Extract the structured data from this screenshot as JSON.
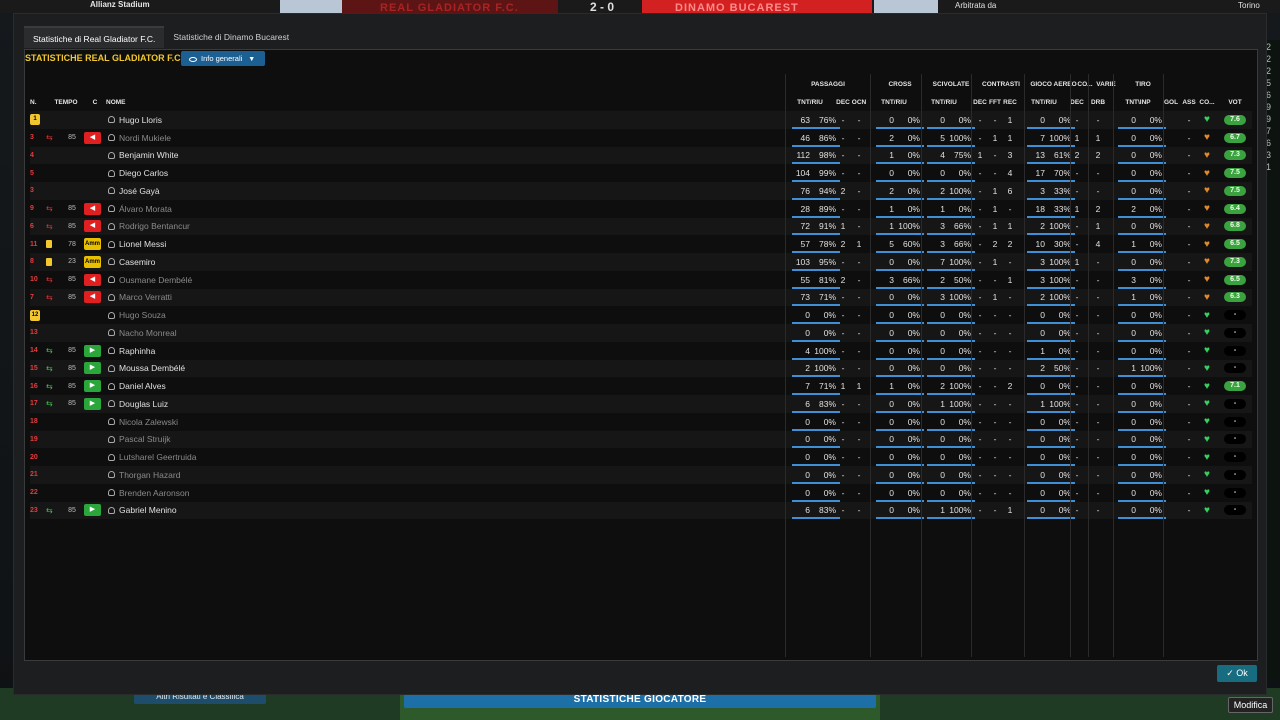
{
  "topbar": {
    "stadium": "Allianz Stadium",
    "referee_label": "Arbitrata da",
    "city": "Torino",
    "home_team_banner": "REAL GLADIATOR F.C.",
    "away_team_banner": "DINAMO BUCAREST",
    "score": "2 - 0"
  },
  "dialog": {
    "tabs": [
      "Statistiche di Real Gladiator F.C.",
      "Statistiche di Dinamo Bucarest"
    ],
    "panel_title": "STATISTICHE REAL GLADIATOR F.C.",
    "view_button": "Info generali",
    "group_headers": {
      "passaggi": "PASSAGGI",
      "cross": "CROSS",
      "scivolate": "SCIVOLATE",
      "contrasti": "CONTRASTI",
      "gioco_aereo": "GIOCO AEREO",
      "co": "CO...",
      "varie": "VARIE",
      "tiro": "TIRO"
    },
    "col_headers": {
      "n": "N.",
      "tempo": "TEMPO",
      "c": "C",
      "nome": "NOME",
      "tnt_riu": "TNT/RIU",
      "dec": "DEC",
      "ocn": "OCN",
      "fft": "FFT",
      "rec": "REC",
      "drb": "DRB",
      "tnt_inp": "TNT\\INP",
      "gol": "GOL",
      "ass": "ASS",
      "co": "CO...",
      "vot": "VOT"
    },
    "rows": [
      {
        "n": "1",
        "shirt": true,
        "dim": false,
        "tempo": "",
        "event": "",
        "cbox": "",
        "name": "Hugo Lloris",
        "pa": "63",
        "pp": "76%",
        "dec": "-",
        "ocn": "-",
        "cra": "0",
        "crp": "0%",
        "sca": "0",
        "scp": "0%",
        "cd": "-",
        "cf": "-",
        "cr": "1",
        "gaa": "0",
        "gap": "0%",
        "co": "-",
        "dr": "-",
        "ta": "0",
        "tp": "0%",
        "gol": "",
        "ass": "-",
        "heart": "#36d160",
        "vot": "7.6",
        "vg": true
      },
      {
        "n": "3",
        "shirt": false,
        "dim": true,
        "tempo": "85",
        "event": "out",
        "cbox": "red",
        "name": "Nordi Mukiele",
        "pa": "46",
        "pp": "86%",
        "dec": "-",
        "ocn": "-",
        "cra": "2",
        "crp": "0%",
        "sca": "5",
        "scp": "100%",
        "cd": "-",
        "cf": "1",
        "cr": "1",
        "gaa": "7",
        "gap": "100%",
        "co": "1",
        "dr": "1",
        "ta": "0",
        "tp": "0%",
        "gol": "",
        "ass": "-",
        "heart": "#e08a2c",
        "vot": "6.7",
        "vg": true
      },
      {
        "n": "4",
        "shirt": false,
        "dim": false,
        "tempo": "",
        "event": "",
        "cbox": "",
        "name": "Benjamin White",
        "pa": "112",
        "pp": "98%",
        "dec": "-",
        "ocn": "-",
        "cra": "1",
        "crp": "0%",
        "sca": "4",
        "scp": "75%",
        "cd": "1",
        "cf": "-",
        "cr": "3",
        "gaa": "13",
        "gap": "61%",
        "co": "2",
        "dr": "2",
        "ta": "0",
        "tp": "0%",
        "gol": "",
        "ass": "-",
        "heart": "#e08a2c",
        "vot": "7.3",
        "vg": true
      },
      {
        "n": "5",
        "shirt": false,
        "dim": false,
        "tempo": "",
        "event": "",
        "cbox": "",
        "name": "Diego Carlos",
        "pa": "104",
        "pp": "99%",
        "dec": "-",
        "ocn": "-",
        "cra": "0",
        "crp": "0%",
        "sca": "0",
        "scp": "0%",
        "cd": "-",
        "cf": "-",
        "cr": "4",
        "gaa": "17",
        "gap": "70%",
        "co": "-",
        "dr": "-",
        "ta": "0",
        "tp": "0%",
        "gol": "",
        "ass": "-",
        "heart": "#e08a2c",
        "vot": "7.5",
        "vg": true
      },
      {
        "n": "3",
        "shirt": false,
        "dim": false,
        "tempo": "",
        "event": "",
        "cbox": "",
        "name": "José Gayà",
        "pa": "76",
        "pp": "94%",
        "dec": "2",
        "ocn": "-",
        "cra": "2",
        "crp": "0%",
        "sca": "2",
        "scp": "100%",
        "cd": "-",
        "cf": "1",
        "cr": "6",
        "gaa": "3",
        "gap": "33%",
        "co": "-",
        "dr": "-",
        "ta": "0",
        "tp": "0%",
        "gol": "",
        "ass": "-",
        "heart": "#e08a2c",
        "vot": "7.5",
        "vg": true
      },
      {
        "n": "9",
        "shirt": false,
        "dim": true,
        "tempo": "85",
        "event": "out",
        "cbox": "red",
        "name": "Álvaro Morata",
        "pa": "28",
        "pp": "89%",
        "dec": "-",
        "ocn": "-",
        "cra": "1",
        "crp": "0%",
        "sca": "1",
        "scp": "0%",
        "cd": "-",
        "cf": "1",
        "cr": "-",
        "gaa": "18",
        "gap": "33%",
        "co": "1",
        "dr": "2",
        "ta": "2",
        "tp": "0%",
        "gol": "",
        "ass": "-",
        "heart": "#e08a2c",
        "vot": "6.4",
        "vg": true
      },
      {
        "n": "6",
        "shirt": false,
        "dim": true,
        "tempo": "85",
        "event": "out",
        "cbox": "red",
        "name": "Rodrigo Bentancur",
        "pa": "72",
        "pp": "91%",
        "dec": "1",
        "ocn": "-",
        "cra": "1",
        "crp": "100%",
        "sca": "3",
        "scp": "66%",
        "cd": "-",
        "cf": "1",
        "cr": "1",
        "gaa": "2",
        "gap": "100%",
        "co": "-",
        "dr": "1",
        "ta": "0",
        "tp": "0%",
        "gol": "",
        "ass": "-",
        "heart": "#e08a2c",
        "vot": "6.8",
        "vg": true
      },
      {
        "n": "11",
        "shirt": false,
        "dim": false,
        "tempo": "78",
        "event": "yellow",
        "cbox": "amm",
        "name": "Lionel Messi",
        "pa": "57",
        "pp": "78%",
        "dec": "2",
        "ocn": "1",
        "cra": "5",
        "crp": "60%",
        "sca": "3",
        "scp": "66%",
        "cd": "-",
        "cf": "2",
        "cr": "2",
        "gaa": "10",
        "gap": "30%",
        "co": "-",
        "dr": "4",
        "ta": "1",
        "tp": "0%",
        "gol": "",
        "ass": "-",
        "heart": "#e08a2c",
        "vot": "6.5",
        "vg": true
      },
      {
        "n": "8",
        "shirt": false,
        "dim": false,
        "tempo": "23",
        "event": "yellow",
        "cbox": "amm",
        "name": "Casemiro",
        "pa": "103",
        "pp": "95%",
        "dec": "-",
        "ocn": "-",
        "cra": "0",
        "crp": "0%",
        "sca": "7",
        "scp": "100%",
        "cd": "-",
        "cf": "1",
        "cr": "-",
        "gaa": "3",
        "gap": "100%",
        "co": "1",
        "dr": "-",
        "ta": "0",
        "tp": "0%",
        "gol": "",
        "ass": "-",
        "heart": "#e08a2c",
        "vot": "7.3",
        "vg": true
      },
      {
        "n": "10",
        "shirt": false,
        "dim": true,
        "tempo": "85",
        "event": "out",
        "cbox": "red",
        "name": "Ousmane Dembélé",
        "pa": "55",
        "pp": "81%",
        "dec": "2",
        "ocn": "-",
        "cra": "3",
        "crp": "66%",
        "sca": "2",
        "scp": "50%",
        "cd": "-",
        "cf": "-",
        "cr": "1",
        "gaa": "3",
        "gap": "100%",
        "co": "-",
        "dr": "-",
        "ta": "3",
        "tp": "0%",
        "gol": "",
        "ass": "-",
        "heart": "#e08a2c",
        "vot": "6.5",
        "vg": true
      },
      {
        "n": "7",
        "shirt": false,
        "dim": true,
        "tempo": "85",
        "event": "out",
        "cbox": "red",
        "name": "Marco Verratti",
        "pa": "73",
        "pp": "71%",
        "dec": "-",
        "ocn": "-",
        "cra": "0",
        "crp": "0%",
        "sca": "3",
        "scp": "100%",
        "cd": "-",
        "cf": "1",
        "cr": "-",
        "gaa": "2",
        "gap": "100%",
        "co": "-",
        "dr": "-",
        "ta": "1",
        "tp": "0%",
        "gol": "",
        "ass": "-",
        "heart": "#e08a2c",
        "vot": "6.3",
        "vg": true
      },
      {
        "n": "12",
        "shirt": true,
        "dim": true,
        "tempo": "",
        "event": "",
        "cbox": "",
        "name": "Hugo Souza",
        "pa": "0",
        "pp": "0%",
        "dec": "-",
        "ocn": "-",
        "cra": "0",
        "crp": "0%",
        "sca": "0",
        "scp": "0%",
        "cd": "-",
        "cf": "-",
        "cr": "-",
        "gaa": "0",
        "gap": "0%",
        "co": "-",
        "dr": "-",
        "ta": "0",
        "tp": "0%",
        "gol": "",
        "ass": "-",
        "heart": "#36d160",
        "vot": "-",
        "vg": false
      },
      {
        "n": "13",
        "shirt": false,
        "dim": true,
        "tempo": "",
        "event": "",
        "cbox": "",
        "name": "Nacho Monreal",
        "pa": "0",
        "pp": "0%",
        "dec": "-",
        "ocn": "-",
        "cra": "0",
        "crp": "0%",
        "sca": "0",
        "scp": "0%",
        "cd": "-",
        "cf": "-",
        "cr": "-",
        "gaa": "0",
        "gap": "0%",
        "co": "-",
        "dr": "-",
        "ta": "0",
        "tp": "0%",
        "gol": "",
        "ass": "-",
        "heart": "#36d160",
        "vot": "-",
        "vg": false
      },
      {
        "n": "14",
        "shirt": false,
        "dim": false,
        "tempo": "85",
        "event": "in",
        "cbox": "green",
        "name": "Raphinha",
        "pa": "4",
        "pp": "100%",
        "dec": "-",
        "ocn": "-",
        "cra": "0",
        "crp": "0%",
        "sca": "0",
        "scp": "0%",
        "cd": "-",
        "cf": "-",
        "cr": "-",
        "gaa": "1",
        "gap": "0%",
        "co": "-",
        "dr": "-",
        "ta": "0",
        "tp": "0%",
        "gol": "",
        "ass": "-",
        "heart": "#36d160",
        "vot": "-",
        "vg": false
      },
      {
        "n": "15",
        "shirt": false,
        "dim": false,
        "tempo": "85",
        "event": "in",
        "cbox": "green",
        "name": "Moussa Dembélé",
        "pa": "2",
        "pp": "100%",
        "dec": "-",
        "ocn": "-",
        "cra": "0",
        "crp": "0%",
        "sca": "0",
        "scp": "0%",
        "cd": "-",
        "cf": "-",
        "cr": "-",
        "gaa": "2",
        "gap": "50%",
        "co": "-",
        "dr": "-",
        "ta": "1",
        "tp": "100%",
        "gol": "",
        "ass": "-",
        "heart": "#36d160",
        "vot": "-",
        "vg": false
      },
      {
        "n": "16",
        "shirt": false,
        "dim": false,
        "tempo": "85",
        "event": "in",
        "cbox": "green",
        "name": "Daniel Alves",
        "pa": "7",
        "pp": "71%",
        "dec": "1",
        "ocn": "1",
        "cra": "1",
        "crp": "0%",
        "sca": "2",
        "scp": "100%",
        "cd": "-",
        "cf": "-",
        "cr": "2",
        "gaa": "0",
        "gap": "0%",
        "co": "-",
        "dr": "-",
        "ta": "0",
        "tp": "0%",
        "gol": "",
        "ass": "-",
        "heart": "#36d160",
        "vot": "7.1",
        "vg": true
      },
      {
        "n": "17",
        "shirt": false,
        "dim": false,
        "tempo": "85",
        "event": "in",
        "cbox": "green",
        "name": "Douglas Luiz",
        "pa": "6",
        "pp": "83%",
        "dec": "-",
        "ocn": "-",
        "cra": "0",
        "crp": "0%",
        "sca": "1",
        "scp": "100%",
        "cd": "-",
        "cf": "-",
        "cr": "-",
        "gaa": "1",
        "gap": "100%",
        "co": "-",
        "dr": "-",
        "ta": "0",
        "tp": "0%",
        "gol": "",
        "ass": "-",
        "heart": "#36d160",
        "vot": "-",
        "vg": false
      },
      {
        "n": "18",
        "shirt": false,
        "dim": true,
        "tempo": "",
        "event": "",
        "cbox": "",
        "name": "Nicola Zalewski",
        "pa": "0",
        "pp": "0%",
        "dec": "-",
        "ocn": "-",
        "cra": "0",
        "crp": "0%",
        "sca": "0",
        "scp": "0%",
        "cd": "-",
        "cf": "-",
        "cr": "-",
        "gaa": "0",
        "gap": "0%",
        "co": "-",
        "dr": "-",
        "ta": "0",
        "tp": "0%",
        "gol": "",
        "ass": "-",
        "heart": "#36d160",
        "vot": "-",
        "vg": false
      },
      {
        "n": "19",
        "shirt": false,
        "dim": true,
        "tempo": "",
        "event": "",
        "cbox": "",
        "name": "Pascal Struijk",
        "pa": "0",
        "pp": "0%",
        "dec": "-",
        "ocn": "-",
        "cra": "0",
        "crp": "0%",
        "sca": "0",
        "scp": "0%",
        "cd": "-",
        "cf": "-",
        "cr": "-",
        "gaa": "0",
        "gap": "0%",
        "co": "-",
        "dr": "-",
        "ta": "0",
        "tp": "0%",
        "gol": "",
        "ass": "-",
        "heart": "#36d160",
        "vot": "-",
        "vg": false
      },
      {
        "n": "20",
        "shirt": false,
        "dim": true,
        "tempo": "",
        "event": "",
        "cbox": "",
        "name": "Lutsharel Geertruida",
        "pa": "0",
        "pp": "0%",
        "dec": "-",
        "ocn": "-",
        "cra": "0",
        "crp": "0%",
        "sca": "0",
        "scp": "0%",
        "cd": "-",
        "cf": "-",
        "cr": "-",
        "gaa": "0",
        "gap": "0%",
        "co": "-",
        "dr": "-",
        "ta": "0",
        "tp": "0%",
        "gol": "",
        "ass": "-",
        "heart": "#36d160",
        "vot": "-",
        "vg": false
      },
      {
        "n": "21",
        "shirt": false,
        "dim": true,
        "tempo": "",
        "event": "",
        "cbox": "",
        "name": "Thorgan Hazard",
        "pa": "0",
        "pp": "0%",
        "dec": "-",
        "ocn": "-",
        "cra": "0",
        "crp": "0%",
        "sca": "0",
        "scp": "0%",
        "cd": "-",
        "cf": "-",
        "cr": "-",
        "gaa": "0",
        "gap": "0%",
        "co": "-",
        "dr": "-",
        "ta": "0",
        "tp": "0%",
        "gol": "",
        "ass": "-",
        "heart": "#36d160",
        "vot": "-",
        "vg": false
      },
      {
        "n": "22",
        "shirt": false,
        "dim": true,
        "tempo": "",
        "event": "",
        "cbox": "",
        "name": "Brenden Aaronson",
        "pa": "0",
        "pp": "0%",
        "dec": "-",
        "ocn": "-",
        "cra": "0",
        "crp": "0%",
        "sca": "0",
        "scp": "0%",
        "cd": "-",
        "cf": "-",
        "cr": "-",
        "gaa": "0",
        "gap": "0%",
        "co": "-",
        "dr": "-",
        "ta": "0",
        "tp": "0%",
        "gol": "",
        "ass": "-",
        "heart": "#36d160",
        "vot": "-",
        "vg": false
      },
      {
        "n": "23",
        "shirt": false,
        "dim": false,
        "tempo": "85",
        "event": "in",
        "cbox": "green",
        "name": "Gabriel Menino",
        "pa": "6",
        "pp": "83%",
        "dec": "-",
        "ocn": "-",
        "cra": "0",
        "crp": "0%",
        "sca": "1",
        "scp": "100%",
        "cd": "-",
        "cf": "-",
        "cr": "1",
        "gaa": "0",
        "gap": "0%",
        "co": "-",
        "dr": "-",
        "ta": "0",
        "tp": "0%",
        "gol": "",
        "ass": "-",
        "heart": "#36d160",
        "vot": "-",
        "vg": false
      }
    ],
    "ok_label": "Ok",
    "amm_label": "Amm"
  },
  "bottom": {
    "results_button": "Altri Risultati e Classifica",
    "stats_button": "STATISTICHE GIOCATORE",
    "modifica": "Modifica"
  },
  "right_numbers": [
    "2",
    "2",
    "2",
    "5",
    "6",
    "9",
    "9",
    "7",
    "6",
    "3",
    "1"
  ],
  "colors": {
    "accent_yellow": "#f2c82e",
    "header_blue": "#1c5f93",
    "ok_teal": "#176c80",
    "progress_blue": "#3f8fd6",
    "good_heart": "#36d160",
    "mid_heart": "#e08a2c"
  }
}
